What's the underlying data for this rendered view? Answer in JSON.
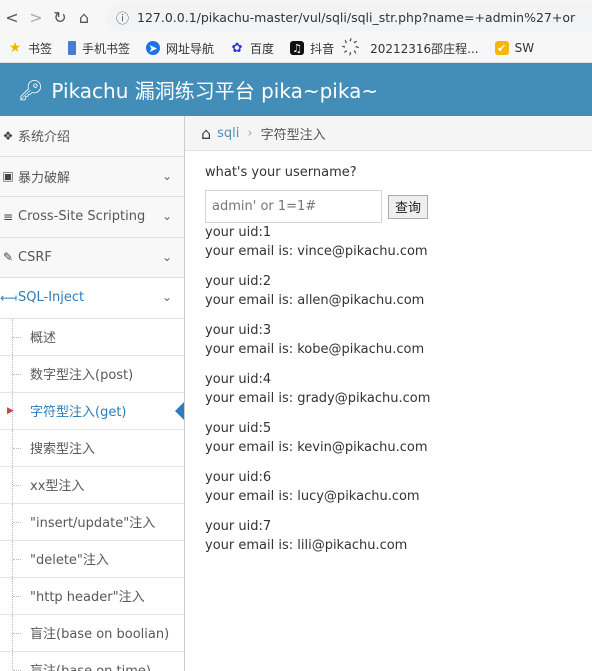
{
  "browser": {
    "url": "127.0.0.1/pikachu-master/vul/sqli/sqli_str.php?name=+admin%27+or",
    "bookmarks": [
      {
        "icon": "star-icon",
        "label": "书签",
        "color": "#f2b600"
      },
      {
        "icon": "bookmark-icon",
        "label": "手机书签",
        "color": "#4a7bd6"
      },
      {
        "icon": "compass-icon",
        "label": "网址导航",
        "color": "#1a73e8"
      },
      {
        "icon": "paw-icon",
        "label": "百度",
        "color": "#2932e1"
      },
      {
        "icon": "tiktok-icon",
        "label": "抖音",
        "color": "#111111"
      },
      {
        "icon": "folder-icon",
        "label": "20212316邵庄程...",
        "color": "#444444"
      },
      {
        "icon": "sw-icon",
        "label": "SW",
        "color": "#f5b800"
      }
    ]
  },
  "header": {
    "title": "Pikachu 漏洞练习平台 pika~pika~"
  },
  "sidebar": {
    "items": [
      {
        "label": "系统介绍",
        "icon": "tag-icon"
      },
      {
        "label": "暴力破解",
        "icon": "lock-icon"
      },
      {
        "label": "Cross-Site Scripting",
        "icon": "list-icon"
      },
      {
        "label": "CSRF",
        "icon": "edit-icon"
      },
      {
        "label": "SQL-Inject",
        "icon": "arrows-icon"
      }
    ],
    "subitems": [
      "概述",
      "数字型注入(post)",
      "字符型注入(get)",
      "搜索型注入",
      "xx型注入",
      "\"insert/update\"注入",
      "\"delete\"注入",
      "\"http header\"注入",
      "盲注(base on boolian)",
      "盲注(base on time)"
    ]
  },
  "breadcrumb": {
    "section": "sqli",
    "page": "字符型注入"
  },
  "main": {
    "prompt": "what's your username?",
    "input_placeholder": "admin' or 1=1#",
    "submit_label": "查询",
    "results": [
      {
        "uid": "your uid:1",
        "email": "your email is: vince@pikachu.com"
      },
      {
        "uid": "your uid:2",
        "email": "your email is: allen@pikachu.com"
      },
      {
        "uid": "your uid:3",
        "email": "your email is: kobe@pikachu.com"
      },
      {
        "uid": "your uid:4",
        "email": "your email is: grady@pikachu.com"
      },
      {
        "uid": "your uid:5",
        "email": "your email is: kevin@pikachu.com"
      },
      {
        "uid": "your uid:6",
        "email": "your email is: lucy@pikachu.com"
      },
      {
        "uid": "your uid:7",
        "email": "your email is: lili@pikachu.com"
      }
    ]
  },
  "colors": {
    "header": "#438eb9",
    "accent": "#2b7dbc"
  }
}
